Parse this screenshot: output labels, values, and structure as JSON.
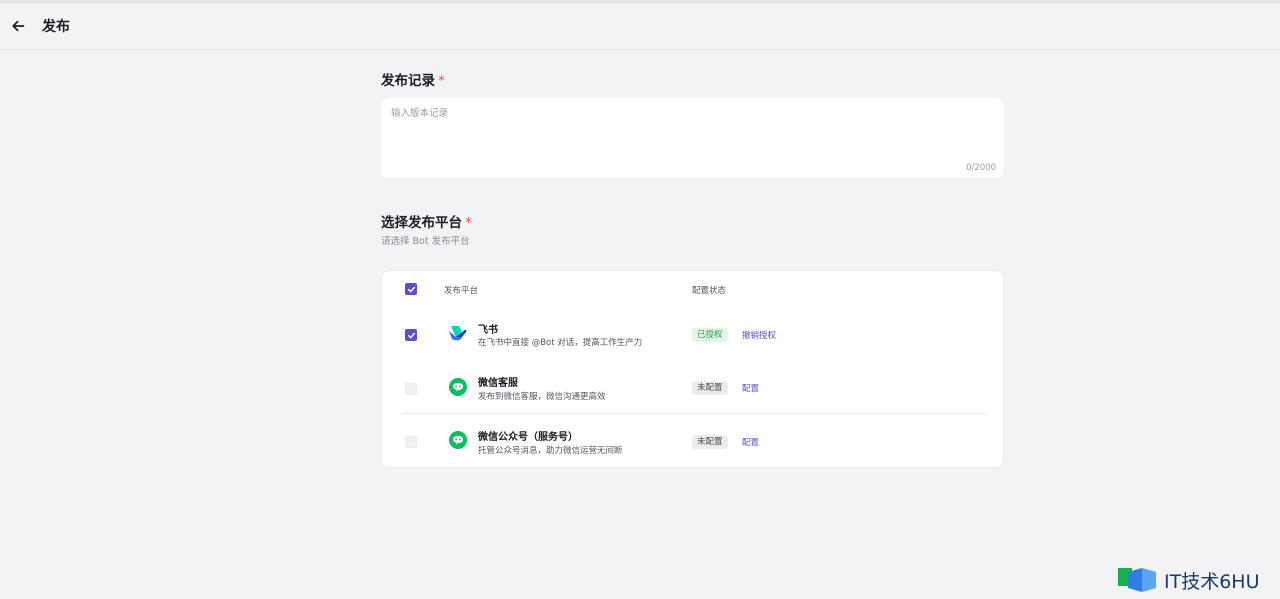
{
  "header": {
    "title": "发布",
    "back_icon": "arrow-left-icon"
  },
  "release_notes": {
    "label": "发布记录",
    "required_mark": "*",
    "placeholder": "输入版本记录",
    "value": "",
    "counter": "0/2000"
  },
  "platform_section": {
    "label": "选择发布平台",
    "required_mark": "*",
    "subtitle": "请选择 Bot 发布平台"
  },
  "table": {
    "columns": {
      "platform": "发布平台",
      "status": "配置状态"
    },
    "header_checked": true,
    "rows": [
      {
        "name": "飞书",
        "description": "在飞书中直接 @Bot 对话，提高工作生产力",
        "icon": "feishu-icon",
        "checked": true,
        "status": "已授权",
        "status_color": "#2d9c4f",
        "action": "撤销授权"
      },
      {
        "name": "微信客服",
        "description": "发布到微信客服，微信沟通更高效",
        "icon": "wechat-icon",
        "checked": false,
        "status": "未配置",
        "status_color": "#4a4b52",
        "action": "配置"
      },
      {
        "name": "微信公众号（服务号）",
        "description": "托管公众号消息，助力微信运营无间断",
        "icon": "wechat-icon",
        "checked": false,
        "status": "未配置",
        "status_color": "#4a4b52",
        "action": "配置"
      }
    ]
  },
  "colors": {
    "accent": "#5b4fcc",
    "wechat_green": "#07c160",
    "required": "#f54a45"
  },
  "watermark": {
    "text": "IT技术6HU"
  }
}
